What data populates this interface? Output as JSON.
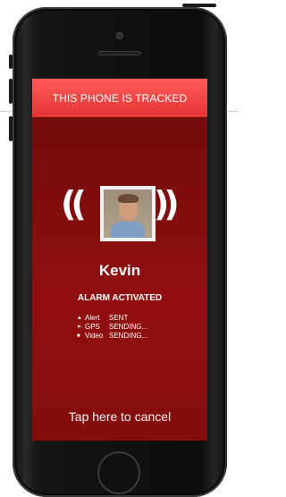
{
  "screen": {
    "banner": "THIS PHONE IS TRACKED",
    "contact_name": "Kevin",
    "alarm_text": "ALARM ACTIVATED",
    "status_items": [
      {
        "icon": "alert-icon",
        "label": "Alert",
        "value": "SENT"
      },
      {
        "icon": "gps-icon",
        "label": "GPS",
        "value": "SENDING..."
      },
      {
        "icon": "video-icon",
        "label": "Video",
        "value": "SENDING..."
      }
    ],
    "cancel_label": "Tap here to cancel"
  },
  "icons": {
    "left_wave": "(( ",
    "right_wave": " ))",
    "alert_glyph": "▲",
    "gps_glyph": "➤",
    "video_glyph": "■"
  },
  "colors": {
    "banner": "#e53535",
    "screen_background": "#7d0c0c",
    "text": "#ffffff"
  }
}
